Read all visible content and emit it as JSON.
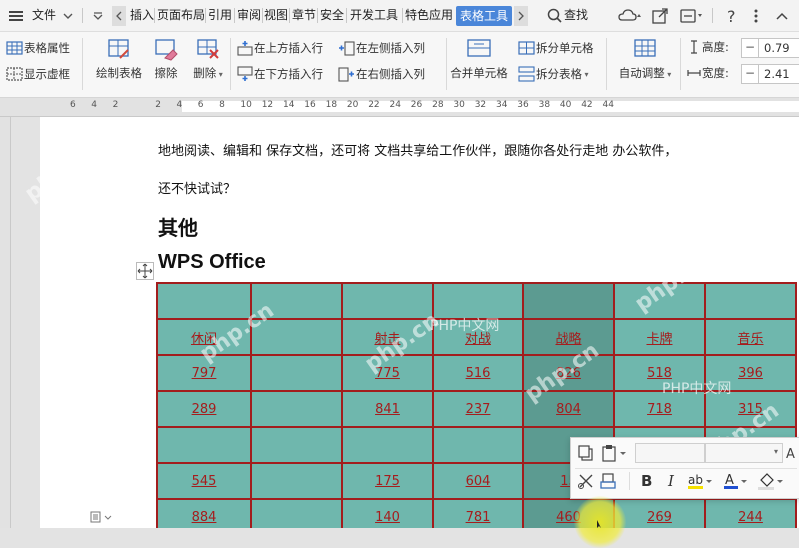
{
  "menubar": {
    "file_label": "文件",
    "tabs": [
      "插入",
      "页面布局",
      "引用",
      "审阅",
      "视图",
      "章节",
      "安全",
      "开发工具",
      "特色应用",
      "表格工具"
    ],
    "search_label": "查找"
  },
  "ribbon": {
    "table_properties": "表格属性",
    "show_gridlines": "显示虚框",
    "draw_table": "绘制表格",
    "erase": "擦除",
    "delete": "删除",
    "insert_row_above": "在上方插入行",
    "insert_row_below": "在下方插入行",
    "insert_col_left": "在左侧插入列",
    "insert_col_right": "在右侧插入列",
    "merge_cells": "合并单元格",
    "split_cells": "拆分单元格",
    "split_table": "拆分表格",
    "auto_fit": "自动调整",
    "height_label": "高度:",
    "height_value": "0.79",
    "width_label": "宽度:",
    "width_value": "2.41"
  },
  "ruler": {
    "ticks": [
      "6",
      "4",
      "2",
      "",
      "2",
      "4",
      "6",
      "8",
      "10",
      "12",
      "14",
      "16",
      "18",
      "20",
      "22",
      "24",
      "26",
      "28",
      "30",
      "32",
      "34",
      "36",
      "38",
      "40",
      "42",
      "44"
    ]
  },
  "document": {
    "para1": "地地阅读、编辑和 保存文档，还可将 文档共享给工作伙伴，跟随你各处行走地 办公软件，",
    "para2": "还不快试试？",
    "heading1": "其他",
    "heading2": "WPS Office"
  },
  "table": {
    "rows": [
      [
        "",
        "",
        "",
        "",
        "",
        "",
        ""
      ],
      [
        "休闲",
        "",
        "射击",
        "对战",
        "战略",
        "卡牌",
        "音乐"
      ],
      [
        "797",
        "",
        "775",
        "516",
        "826",
        "518",
        "396"
      ],
      [
        "289",
        "",
        "841",
        "237",
        "804",
        "718",
        "315"
      ],
      [
        "",
        "",
        "",
        "",
        "",
        "",
        ""
      ],
      [
        "545",
        "",
        "175",
        "604",
        "15",
        "",
        ""
      ],
      [
        "884",
        "",
        "140",
        "781",
        "460",
        "269",
        "244"
      ]
    ]
  },
  "watermarks": [
    "php.cn",
    "php.cn",
    "php.cn",
    "php.cn",
    "php.cn",
    "php.cn",
    "PHP中文网",
    "PHP中文网"
  ],
  "colors": {
    "accent": "#4a86d9",
    "table_fill": "#6fb7ad",
    "table_border": "#a21d1d"
  }
}
